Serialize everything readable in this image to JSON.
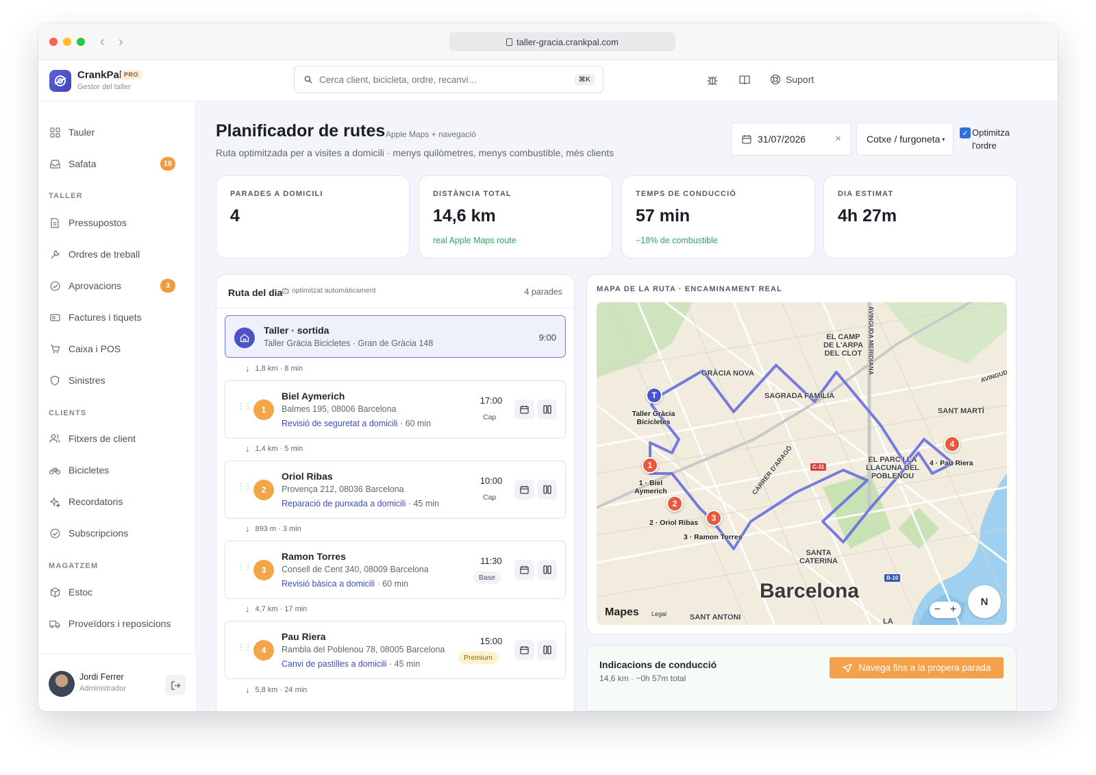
{
  "browser": {
    "url": "taller-gracia.crankpal.com"
  },
  "brand": {
    "name": "CrankPal",
    "badge": "PRO",
    "subtitle": "Gestor del taller"
  },
  "search": {
    "placeholder": "Cerca client, bicicleta, ordre, recanvi…",
    "shortcut": "⌘K"
  },
  "topbar": {
    "bug_icon": "bug-icon",
    "docs_icon": "book-icon",
    "support_label": "Suport"
  },
  "sidebar": {
    "items_top": [
      {
        "label": "Tauler",
        "icon": "grid-icon"
      },
      {
        "label": "Safata",
        "icon": "inbox-icon",
        "badge": "16"
      }
    ],
    "section_taller": "TALLER",
    "items_taller": [
      {
        "label": "Pressupostos",
        "icon": "document-icon"
      },
      {
        "label": "Ordres de treball",
        "icon": "wrench-icon"
      },
      {
        "label": "Aprovacions",
        "icon": "check-circle-icon",
        "badge": "3"
      },
      {
        "label": "Factures i tiquets",
        "icon": "ticket-icon"
      },
      {
        "label": "Caixa i POS",
        "icon": "cart-icon"
      },
      {
        "label": "Sinistres",
        "icon": "shield-icon"
      }
    ],
    "section_clients": "CLIENTS",
    "items_clients": [
      {
        "label": "Fitxers de client",
        "icon": "users-icon"
      },
      {
        "label": "Bicicletes",
        "icon": "bicycle-icon"
      },
      {
        "label": "Recordatoris",
        "icon": "sparkle-icon"
      },
      {
        "label": "Subscripcions",
        "icon": "check-circle-icon"
      }
    ],
    "section_magatzem": "MAGATZEM",
    "items_magatzem": [
      {
        "label": "Estoc",
        "icon": "box-icon"
      },
      {
        "label": "Proveïdors i reposicions",
        "icon": "truck-icon"
      }
    ],
    "user": {
      "name": "Jordi Ferrer",
      "role": "Administrador"
    }
  },
  "page": {
    "title": "Planificador de rutes",
    "title_tag": "Apple Maps + navegació",
    "subtitle": "Ruta optimitzada per a visites a domicili · menys quilòmetres, menys combustible, més clients",
    "date": "31/07/2026",
    "vehicle": "Cotxe / furgoneta",
    "optimize_label": "Optimitza l'ordre",
    "optimize_checked": true
  },
  "stats": [
    {
      "label": "PARADES A DOMICILI",
      "value": "4",
      "note": ""
    },
    {
      "label": "DISTÀNCIA TOTAL",
      "value": "14,6 km",
      "note": "real Apple Maps route"
    },
    {
      "label": "TEMPS DE CONDUCCIÓ",
      "value": "57 min",
      "note": "−18% de combustible"
    },
    {
      "label": "DIA ESTIMAT",
      "value": "4h 27m",
      "note": ""
    }
  ],
  "route": {
    "title": "Ruta del dia",
    "tag": "optimitzat automàticament",
    "count": "4 parades",
    "start": {
      "title": "Taller · sortida",
      "address": "Taller Gràcia Bicicletes · Gran de Gràcia 148",
      "time": "9:00"
    },
    "legs": [
      "1,8 km · 8 min",
      "1,4 km · 5 min",
      "893 m · 3 min",
      "4,7 km · 17 min",
      "5,8 km · 24 min"
    ],
    "stops": [
      {
        "num": "1",
        "name": "Biel Aymerich",
        "address": "Balmes 195, 08006 Barcelona",
        "service": "Revisió de seguretat a domicili",
        "duration": " · 60 min",
        "time": "17:00",
        "tag": "Cap",
        "tag_style": "cap"
      },
      {
        "num": "2",
        "name": "Oriol Ribas",
        "address": "Provença 212, 08036 Barcelona",
        "service": "Reparació de punxada a domicili",
        "duration": " · 45 min",
        "time": "10:00",
        "tag": "Cap",
        "tag_style": "cap"
      },
      {
        "num": "3",
        "name": "Ramon Torres",
        "address": "Consell de Cent 340, 08009 Barcelona",
        "service": "Revisió bàsica a domicili",
        "duration": " · 60 min",
        "time": "11:30",
        "tag": "Base",
        "tag_style": "base"
      },
      {
        "num": "4",
        "name": "Pau Riera",
        "address": "Rambla del Poblenou 78, 08005 Barcelona",
        "service": "Canvi de pastilles a domicili",
        "duration": " · 45 min",
        "time": "15:00",
        "tag": "Premium",
        "tag_style": "premium"
      }
    ]
  },
  "map": {
    "title": "MAPA DE LA RUTA · ENCAMINAMENT REAL",
    "city": "Barcelona",
    "districts": [
      "GRÀCIA NOVA",
      "SAGRADA FAMÍLIA",
      "EL CAMP DE L'ARPA DEL CLOT",
      "SANT MARTÍ",
      "EL PARC I LA LLACUNA DEL POBLENOU",
      "SANTA CATERINA",
      "SANT ANTONI",
      "CARRER D'ARAGÓ",
      "AVINGUDA MERIDIANA",
      "AVINGUD",
      "LA"
    ],
    "pins": [
      {
        "id": "T",
        "label": "Taller Gràcia Bicicletes"
      },
      {
        "id": "1",
        "label": "1 · Biel Aymerich"
      },
      {
        "id": "2",
        "label": "2 · Oriol Ribas"
      },
      {
        "id": "3",
        "label": "3 · Ramon Torres"
      },
      {
        "id": "4",
        "label": "4 · Pau Riera"
      }
    ],
    "road_badges": [
      "C-31",
      "B-10"
    ],
    "provider": "Mapes",
    "legal": "Legal",
    "compass": "N"
  },
  "directions": {
    "title": "Indicacions de conducció",
    "summary": "14,6 km · ~0h 57m total",
    "button": "Navega fins a la propera parada"
  },
  "colors": {
    "accent": "#4b53c6",
    "orange": "#f3a649",
    "pin_red": "#e85a3c",
    "route": "#6a70e0"
  }
}
